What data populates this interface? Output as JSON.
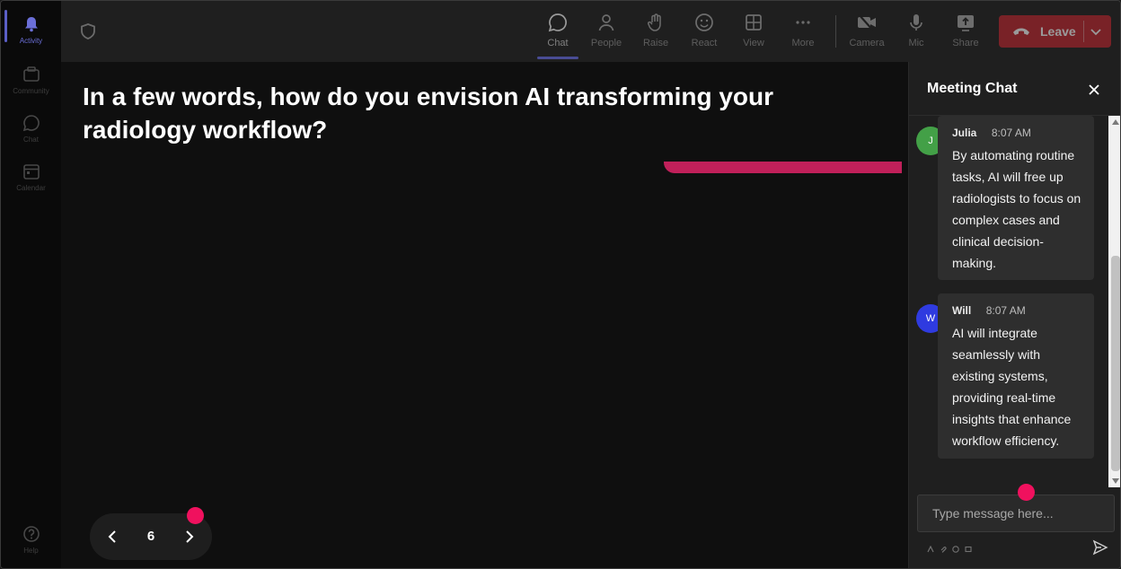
{
  "rail": {
    "items": [
      {
        "label": "Activity",
        "icon": "bell-icon",
        "active": true
      },
      {
        "label": "Community",
        "icon": "community-icon"
      },
      {
        "label": "Chat",
        "icon": "chat-icon"
      },
      {
        "label": "Calendar",
        "icon": "calendar-icon"
      },
      {
        "label": "Help",
        "icon": "help-icon"
      }
    ]
  },
  "toolbar": {
    "chat_label": "Chat",
    "people_label": "People",
    "raise_label": "Raise",
    "react_label": "React",
    "view_label": "View",
    "more_label": "More",
    "camera_label": "Camera",
    "mic_label": "Mic",
    "share_label": "Share",
    "leave_label": "Leave"
  },
  "stage": {
    "question": "In a few words, how do you envision AI transforming your radiology workflow?",
    "page_number": "6"
  },
  "chat": {
    "title": "Meeting Chat",
    "messages": [
      {
        "author": "Julia",
        "initial": "J",
        "time": "8:07 AM",
        "text": "By automating routine tasks, AI will free up radiologists to focus on complex cases and clinical decision-making.",
        "avatar_color": "#43a047"
      },
      {
        "author": "Will",
        "initial": "W",
        "time": "8:07 AM",
        "text": "AI will integrate seamlessly with existing systems, providing real-time insights that enhance workflow efficiency.",
        "avatar_color": "#2f3be0"
      }
    ],
    "compose_placeholder": "Type message here..."
  },
  "colors": {
    "accent": "#5b5fc7",
    "leave": "#c4262e",
    "highlight_dot": "#f0115e",
    "slide_bar": "#c0205a"
  }
}
